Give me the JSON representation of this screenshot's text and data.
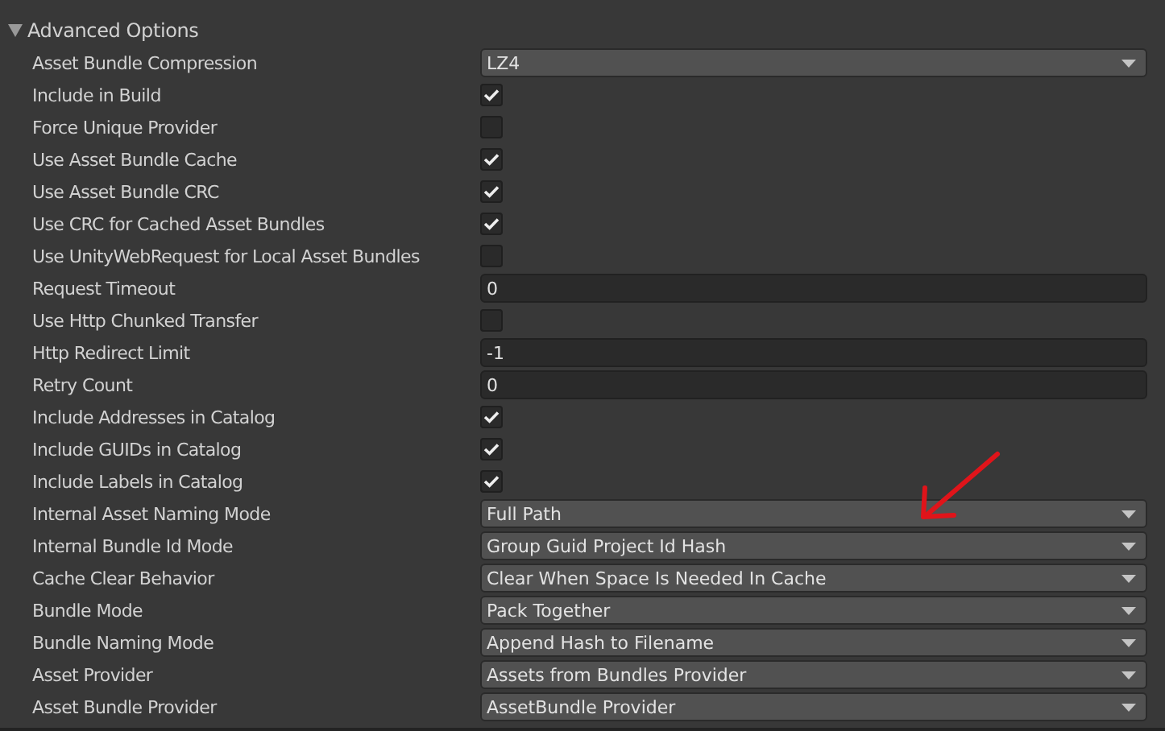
{
  "section": {
    "title": "Advanced Options",
    "expanded": true
  },
  "rows": [
    {
      "label": "Asset Bundle Compression",
      "kind": "dropdown",
      "value": "LZ4"
    },
    {
      "label": "Include in Build",
      "kind": "checkbox",
      "checked": true
    },
    {
      "label": "Force Unique Provider",
      "kind": "checkbox",
      "checked": false
    },
    {
      "label": "Use Asset Bundle Cache",
      "kind": "checkbox",
      "checked": true
    },
    {
      "label": "Use Asset Bundle CRC",
      "kind": "checkbox",
      "checked": true
    },
    {
      "label": "Use CRC for Cached Asset Bundles",
      "kind": "checkbox",
      "checked": true
    },
    {
      "label": "Use UnityWebRequest for Local Asset Bundles",
      "kind": "checkbox",
      "checked": false
    },
    {
      "label": "Request Timeout",
      "kind": "number",
      "value": "0"
    },
    {
      "label": "Use Http Chunked Transfer",
      "kind": "checkbox",
      "checked": false
    },
    {
      "label": "Http Redirect Limit",
      "kind": "number",
      "value": "-1"
    },
    {
      "label": "Retry Count",
      "kind": "number",
      "value": "0"
    },
    {
      "label": "Include Addresses in Catalog",
      "kind": "checkbox",
      "checked": true
    },
    {
      "label": "Include GUIDs in Catalog",
      "kind": "checkbox",
      "checked": true
    },
    {
      "label": "Include Labels in Catalog",
      "kind": "checkbox",
      "checked": true
    },
    {
      "label": "Internal Asset Naming Mode",
      "kind": "dropdown",
      "value": "Full Path"
    },
    {
      "label": "Internal Bundle Id Mode",
      "kind": "dropdown",
      "value": "Group Guid Project Id Hash"
    },
    {
      "label": "Cache Clear Behavior",
      "kind": "dropdown",
      "value": "Clear When Space Is Needed In Cache"
    },
    {
      "label": "Bundle Mode",
      "kind": "dropdown",
      "value": "Pack Together"
    },
    {
      "label": "Bundle Naming Mode",
      "kind": "dropdown",
      "value": "Append Hash to Filename"
    },
    {
      "label": "Asset Provider",
      "kind": "dropdown",
      "value": "Assets from Bundles Provider"
    },
    {
      "label": "Asset Bundle Provider",
      "kind": "dropdown",
      "value": "AssetBundle Provider"
    }
  ]
}
